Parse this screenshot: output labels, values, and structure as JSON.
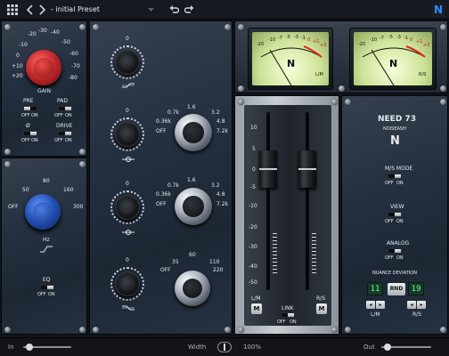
{
  "header": {
    "preset_name": "- initial Preset",
    "logo": "N"
  },
  "input": {
    "gain_scale": [
      "-30",
      "-20",
      "-10",
      "0",
      "+10",
      "+20",
      "-40",
      "-50",
      "-60",
      "-70",
      "-80"
    ],
    "gain_label": "GAIN",
    "pre_label": "PRE",
    "pad_label": "PAD",
    "phase_label": "Ø",
    "drive_label": "DRIVE",
    "off": "OFF",
    "on": "ON",
    "hpf_scale": [
      "50",
      "80",
      "160",
      "300",
      "OFF"
    ],
    "hz_label": "Hz",
    "eq_label": "EQ"
  },
  "eq": {
    "band1": {
      "zero": "0"
    },
    "band1_hf": [
      "1.6",
      "0.7k",
      "3.2",
      "0.36k",
      "4.8",
      "OFF",
      "7.2k"
    ],
    "band2": {
      "zero": "0"
    },
    "band2_hf": [
      "1.6",
      "0.7k",
      "3.2",
      "0.36k",
      "4.8",
      "OFF",
      "7.2k"
    ],
    "band3": {
      "zero": "0"
    },
    "lf": [
      "35",
      "60",
      "110",
      "OFF",
      "220"
    ]
  },
  "meters": {
    "left": {
      "scale": [
        "-20",
        "-10",
        "-7",
        "-5",
        "-3",
        "-1",
        "0",
        "+1",
        "+3"
      ],
      "label": "L/M"
    },
    "right": {
      "scale": [
        "-20",
        "-10",
        "-7",
        "-5",
        "-3",
        "-1",
        "0",
        "+1",
        "+3"
      ],
      "label": "R/S"
    }
  },
  "faders": {
    "scale": [
      "10",
      "5",
      "0",
      "-5",
      "-10",
      "-20",
      "-30",
      "-40",
      "-50"
    ],
    "left_btn": "M",
    "right_btn": "M",
    "left_label": "L/M",
    "right_label": "R/S",
    "link_label": "LINK",
    "off": "OFF",
    "on": "ON"
  },
  "brand": {
    "model": "NEED 73",
    "maker": "NOISEASH",
    "logo": "N",
    "ms_mode": "M/S MODE",
    "view": "VIEW",
    "analog": "ANALOG",
    "off": "OFF",
    "on": "ON",
    "nuance": "NUANCE DEVIATION",
    "left_value": "11",
    "rnd": "RND",
    "right_value": "19",
    "lm": "L/M",
    "rs": "R/S"
  },
  "footer": {
    "in_label": "In",
    "width_label": "Width",
    "width_value": "100%",
    "out_label": "Out",
    "width_value_num": 100
  },
  "colors": {
    "accent_red": "#c62a2d",
    "accent_blue": "#2353b9",
    "led_green": "#63ff9b"
  }
}
